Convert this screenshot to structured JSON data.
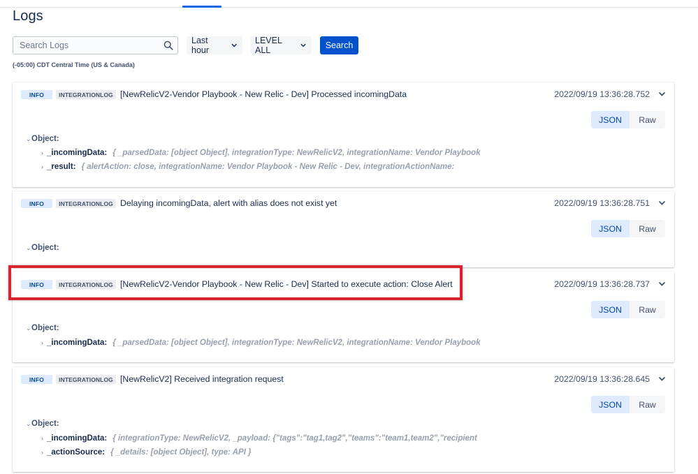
{
  "page": {
    "title": "Logs"
  },
  "toolbar": {
    "search_placeholder": "Search Logs",
    "time_range": "Last hour",
    "level_filter": "LEVEL ALL",
    "search_button": "Search",
    "timezone_note": "(-05:00) CDT Central Time (US & Canada)"
  },
  "view_toggle": {
    "json_label": "JSON",
    "raw_label": "Raw",
    "selected": "JSON"
  },
  "logs": [
    {
      "level": "INFO",
      "type": "INTEGRATIONLOG",
      "message": "[NewRelicV2-Vendor Playbook - New Relic - Dev] Processed incomingData",
      "timestamp": "2022/09/19 13:36:28.752",
      "object_label": "Object:",
      "props": [
        {
          "key": "_incomingData:",
          "value": "{ _parsedData: [object Object], integrationType: NewRelicV2, integrationName: Vendor Playbook"
        },
        {
          "key": "_result:",
          "value": "{ alertAction: close, integrationName: Vendor Playbook - New Relic - Dev, integrationActionName:"
        }
      ]
    },
    {
      "level": "INFO",
      "type": "INTEGRATIONLOG",
      "message": "Delaying incomingData, alert with alias does not exist yet",
      "timestamp": "2022/09/19 13:36:28.751",
      "object_label": "Object:",
      "props": []
    },
    {
      "level": "INFO",
      "type": "INTEGRATIONLOG",
      "message": "[NewRelicV2-Vendor Playbook - New Relic - Dev] Started to execute action: Close Alert",
      "timestamp": "2022/09/19 13:36:28.737",
      "object_label": "Object:",
      "props": [
        {
          "key": "_incomingData:",
          "value": "{ _parsedData: [object Object], integrationType: NewRelicV2, integrationName: Vendor Playbook"
        }
      ]
    },
    {
      "level": "INFO",
      "type": "INTEGRATIONLOG",
      "message": "[NewRelicV2] Received integration request",
      "timestamp": "2022/09/19 13:36:28.645",
      "object_label": "Object:",
      "props": [
        {
          "key": "_incomingData:",
          "value": "{ integrationType: NewRelicV2, _payload: {\"tags\":\"tag1,tag2\",\"teams\":\"team1,team2\",\"recipient"
        },
        {
          "key": "_actionSource:",
          "value": "{ _details: [object Object], type: API }"
        }
      ]
    }
  ],
  "colors": {
    "primary": "#0052cc",
    "info_badge_bg": "#deebff",
    "highlight_border": "#d9232e"
  }
}
